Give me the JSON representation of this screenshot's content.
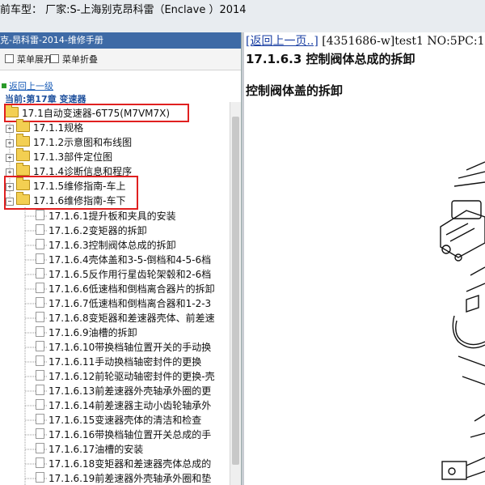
{
  "window": {
    "title": "前车型：  厂家:S-上海别克昂科雷（Enclave ）2014"
  },
  "left_panel": {
    "header": "克-昂科雷-2014-维修手册",
    "toolbar": {
      "expand_label": "菜单展开",
      "collapse_label": "菜单折叠"
    },
    "back_link": "返回上一级",
    "current_label": "当前:第17章 变速器",
    "root_item": "17.1自动变速器-6T75(M7VM7X)",
    "folders": [
      {
        "label": "17.1.1规格",
        "toggle": "+"
      },
      {
        "label": "17.1.2示意图和布线图",
        "toggle": "+"
      },
      {
        "label": "17.1.3部件定位图",
        "toggle": "+"
      },
      {
        "label": "17.1.4诊断信息和程序",
        "toggle": "+"
      },
      {
        "label": "17.1.5维修指南-车上",
        "toggle": "+"
      },
      {
        "label": "17.1.6维修指南-车下",
        "toggle": "−"
      }
    ],
    "pages": [
      "17.1.6.1提升板和夹具的安装",
      "17.1.6.2变矩器的拆卸",
      "17.1.6.3控制阀体总成的拆卸",
      "17.1.6.4壳体盖和3-5-倒档和4-5-6档",
      "17.1.6.5反作用行星齿轮架毂和2-6档",
      "17.1.6.6低速档和倒档离合器片的拆卸",
      "17.1.6.7低速档和倒档离合器和1-2-3",
      "17.1.6.8变矩器和差速器壳体、前差速",
      "17.1.6.9油槽的拆卸",
      "17.1.6.10带换档轴位置开关的手动换",
      "17.1.6.11手动换档轴密封件的更换",
      "17.1.6.12前轮驱动轴密封件的更换-壳",
      "17.1.6.13前差速器外壳轴承外圈的更",
      "17.1.6.14前差速器主动小齿轮轴承外",
      "17.1.6.15变速器壳体的清洁和检查",
      "17.1.6.16带换档轴位置开关总成的手",
      "17.1.6.17油槽的安装",
      "17.1.6.18变矩器和差速器壳体总成的",
      "17.1.6.19前差速器外壳轴承外圈和垫"
    ]
  },
  "right_panel": {
    "back_link": "[返回上一页..]",
    "doc_info": "[4351686-w]test1 NO:5PC:1",
    "section_title": "17.1.6.3 控制阀体总成的拆卸",
    "subsection_title": "控制阀体盖的拆卸"
  },
  "colors": {
    "header_bg": "#3e6aa6",
    "highlight_box": "#e02020",
    "link": "#1a3fa3",
    "folder": "#f3cf52"
  }
}
